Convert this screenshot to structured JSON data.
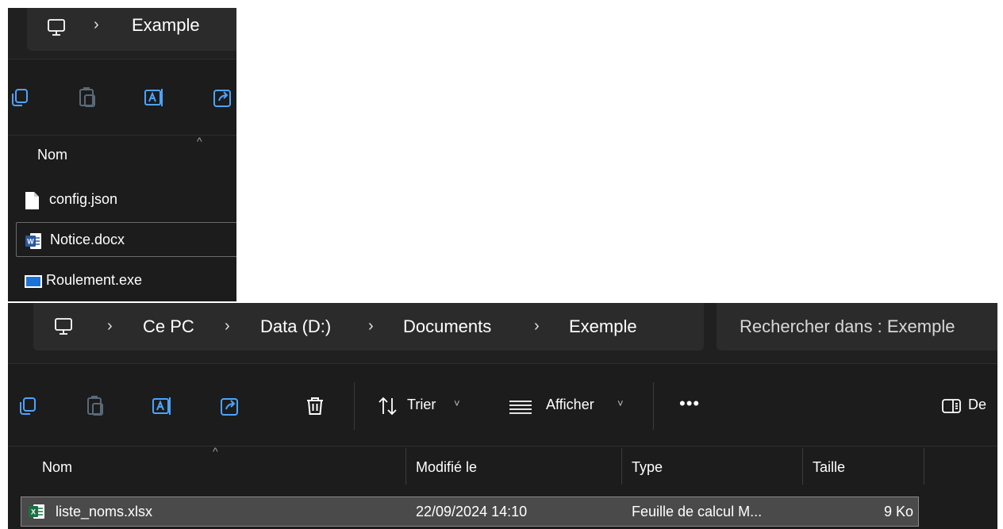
{
  "window_small": {
    "breadcrumb": {
      "chevron": "›",
      "folder": "Example"
    },
    "toolbar": [
      {
        "name": "copy-icon"
      },
      {
        "name": "paste-icon"
      },
      {
        "name": "rename-icon"
      },
      {
        "name": "share-icon"
      }
    ],
    "columns": {
      "name": "Nom"
    },
    "files": [
      {
        "name": "config.json",
        "icon": "generic-file-icon"
      },
      {
        "name": "Notice.docx",
        "icon": "word-file-icon",
        "selected": true
      },
      {
        "name": "Roulement.exe",
        "icon": "exe-file-icon"
      }
    ]
  },
  "window_main": {
    "breadcrumb": {
      "chevron": "›",
      "items": [
        "Ce PC",
        "Data (D:)",
        "Documents",
        "Exemple"
      ]
    },
    "search": {
      "placeholder": "Rechercher dans : Exemple"
    },
    "toolbar": {
      "sort_label": "Trier",
      "view_label": "Afficher",
      "more_label": "•••",
      "details_label": "De",
      "dropdown_glyph": "˅"
    },
    "columns": {
      "name": "Nom",
      "modified": "Modifié le",
      "type": "Type",
      "size": "Taille"
    },
    "files": [
      {
        "name": "liste_noms.xlsx",
        "modified": "22/09/2024 14:10",
        "type": "Feuille de calcul M...",
        "size": "9 Ko",
        "icon": "excel-file-icon",
        "selected": true
      }
    ]
  },
  "colors": {
    "background": "#1c1c1c",
    "address_bar": "#2b2b2b",
    "selection": "#4a4a4a",
    "word_blue": "#2b579a",
    "excel_green": "#1d6f42",
    "exe_blue": "#1a73d9"
  }
}
